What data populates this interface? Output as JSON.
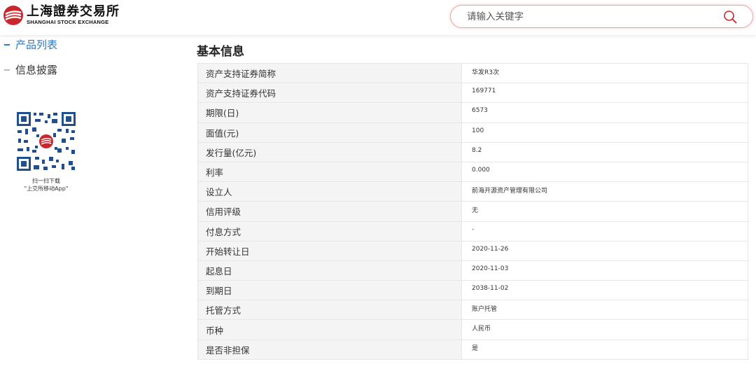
{
  "header": {
    "logo_cn": "上海證券交易所",
    "logo_en": "SHANGHAI STOCK EXCHANGE",
    "search_placeholder": "请输入关键字",
    "search_icon": "search-icon",
    "accent_color": "#c8282d"
  },
  "sidebar": {
    "items": [
      {
        "label": "产品列表",
        "active": true
      },
      {
        "label": "信息披露",
        "active": false
      }
    ],
    "qr_caption_line1": "扫一扫下载",
    "qr_caption_line2": "\"上交所移动App\""
  },
  "main": {
    "title": "基本信息",
    "rows": [
      {
        "key": "资产支持证券简称",
        "value": "华发R3次"
      },
      {
        "key": "资产支持证券代码",
        "value": "169771"
      },
      {
        "key": "期限(日)",
        "value": "6573"
      },
      {
        "key": "面值(元)",
        "value": "100"
      },
      {
        "key": "发行量(亿元)",
        "value": "8.2"
      },
      {
        "key": "利率",
        "value": "0.000"
      },
      {
        "key": "设立人",
        "value": "前海开源资产管理有限公司"
      },
      {
        "key": "信用评级",
        "value": "无"
      },
      {
        "key": "付息方式",
        "value": "-"
      },
      {
        "key": "开始转让日",
        "value": "2020-11-26"
      },
      {
        "key": "起息日",
        "value": "2020-11-03"
      },
      {
        "key": "到期日",
        "value": "2038-11-02"
      },
      {
        "key": "托管方式",
        "value": "账户托管"
      },
      {
        "key": "币种",
        "value": "人民币"
      },
      {
        "key": "是否非担保",
        "value": "是"
      }
    ]
  }
}
